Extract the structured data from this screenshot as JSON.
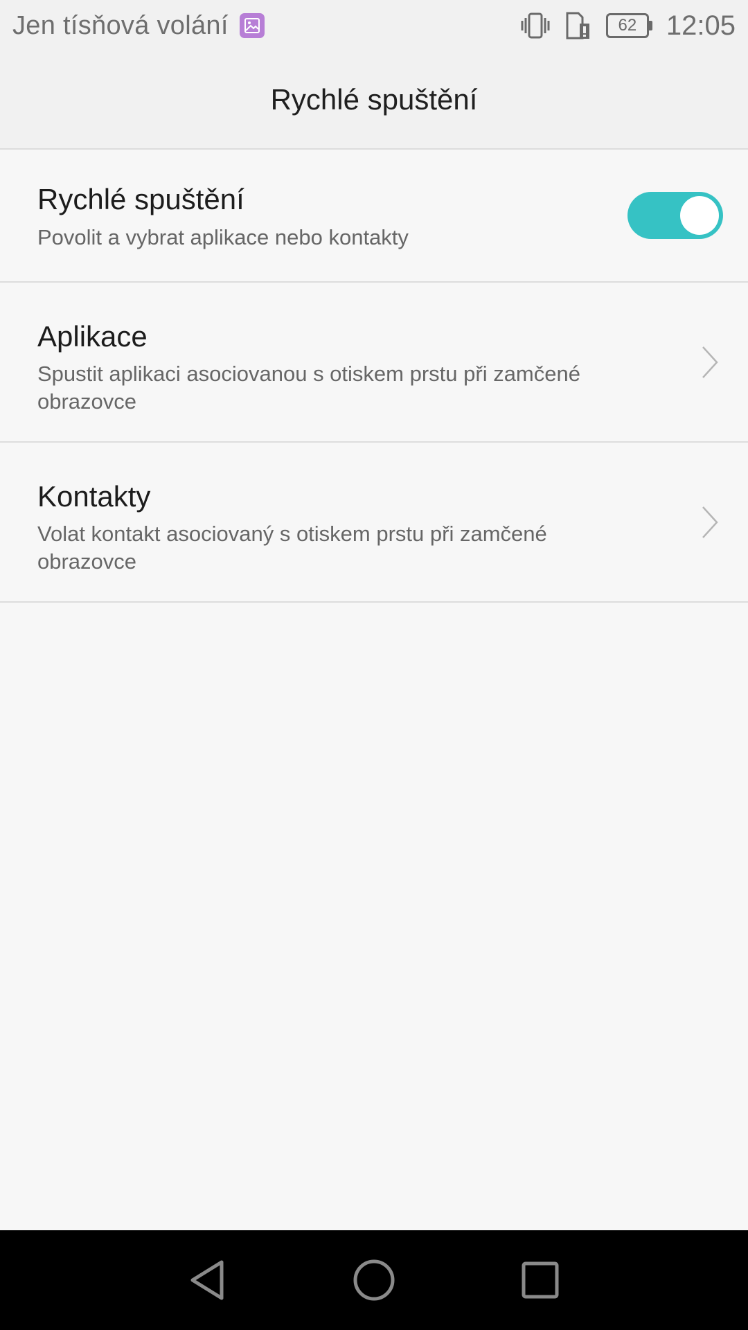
{
  "status_bar": {
    "carrier_text": "Jen tísňová volání",
    "battery_level": "62",
    "time": "12:05",
    "icons": [
      "gallery-icon",
      "vibrate-icon",
      "sim-data-icon",
      "battery-icon"
    ]
  },
  "header": {
    "title": "Rychlé spuštění"
  },
  "settings": {
    "quick_launch": {
      "title": "Rychlé spuštění",
      "subtitle": "Povolit a vybrat aplikace nebo kontakty",
      "enabled": true
    },
    "apps": {
      "title": "Aplikace",
      "subtitle": "Spustit aplikaci asociovanou s otiskem prstu při zamčené obrazovce"
    },
    "contacts": {
      "title": "Kontakty",
      "subtitle": "Volat kontakt asociovaný s otiskem prstu při zamčené obrazovce"
    }
  },
  "colors": {
    "accent": "#36c2c4",
    "status_text": "#6e6e6e",
    "gallery_badge": "#b77ed6"
  },
  "navigation": {
    "buttons": [
      "back-icon",
      "home-icon",
      "recents-icon"
    ]
  }
}
